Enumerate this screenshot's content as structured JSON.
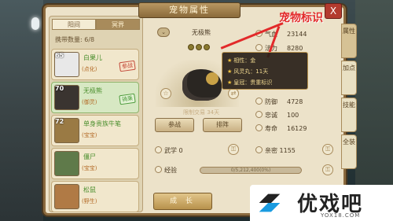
{
  "window": {
    "title": "宠物属性",
    "close_label": "X"
  },
  "annotation": {
    "text": "宠物标识"
  },
  "tabs": [
    {
      "label": "阳间"
    },
    {
      "label": "冥界"
    }
  ],
  "carry": {
    "label": "携带数量:",
    "value": "6/8"
  },
  "pets": [
    {
      "level": "65",
      "name": "白果儿",
      "kind": "(点化)",
      "badge": "参战",
      "color": "#e8e8e8"
    },
    {
      "level": "70",
      "name": "无极熊",
      "kind": "(御灵)",
      "badge": "骑乘",
      "color": "#3a3430"
    },
    {
      "level": "72",
      "name": "单身贵族牛笔",
      "kind": "(宝宝)",
      "badge": "",
      "color": "#9a7a44"
    },
    {
      "level": "",
      "name": "僵尸",
      "kind": "(宝宝)",
      "badge": "",
      "color": "#5f7a4a"
    },
    {
      "level": "",
      "name": "松鼠",
      "kind": "(野生)",
      "badge": "",
      "color": "#b07a45"
    }
  ],
  "detail": {
    "name": "无极熊",
    "trade": "限制交易 34天",
    "fight_btn": "参战",
    "sort_btn": "排阵",
    "wuxue": "武学 0",
    "qinmi": "亲密 1155",
    "exp_label": "经验",
    "exp_value": "0/5,212,400(0%)",
    "grow_btn": "成 长"
  },
  "stats": [
    {
      "k": "气血",
      "v": "23144"
    },
    {
      "k": "法力",
      "v": "8280"
    },
    {
      "k": "防御",
      "v": "4728"
    },
    {
      "k": "忠诚",
      "v": "100"
    },
    {
      "k": "寿命",
      "v": "16129"
    }
  ],
  "tooltip": [
    {
      "text": "相性：金"
    },
    {
      "text": "风灵丸：11天"
    },
    {
      "text": "皇冠：贵重标识"
    }
  ],
  "side_tabs": [
    {
      "label": "属性"
    },
    {
      "label": "加点"
    },
    {
      "label": "技能"
    },
    {
      "label": "全装"
    }
  ],
  "logo": {
    "text": "优戏吧",
    "url": "YOX18.COM"
  }
}
